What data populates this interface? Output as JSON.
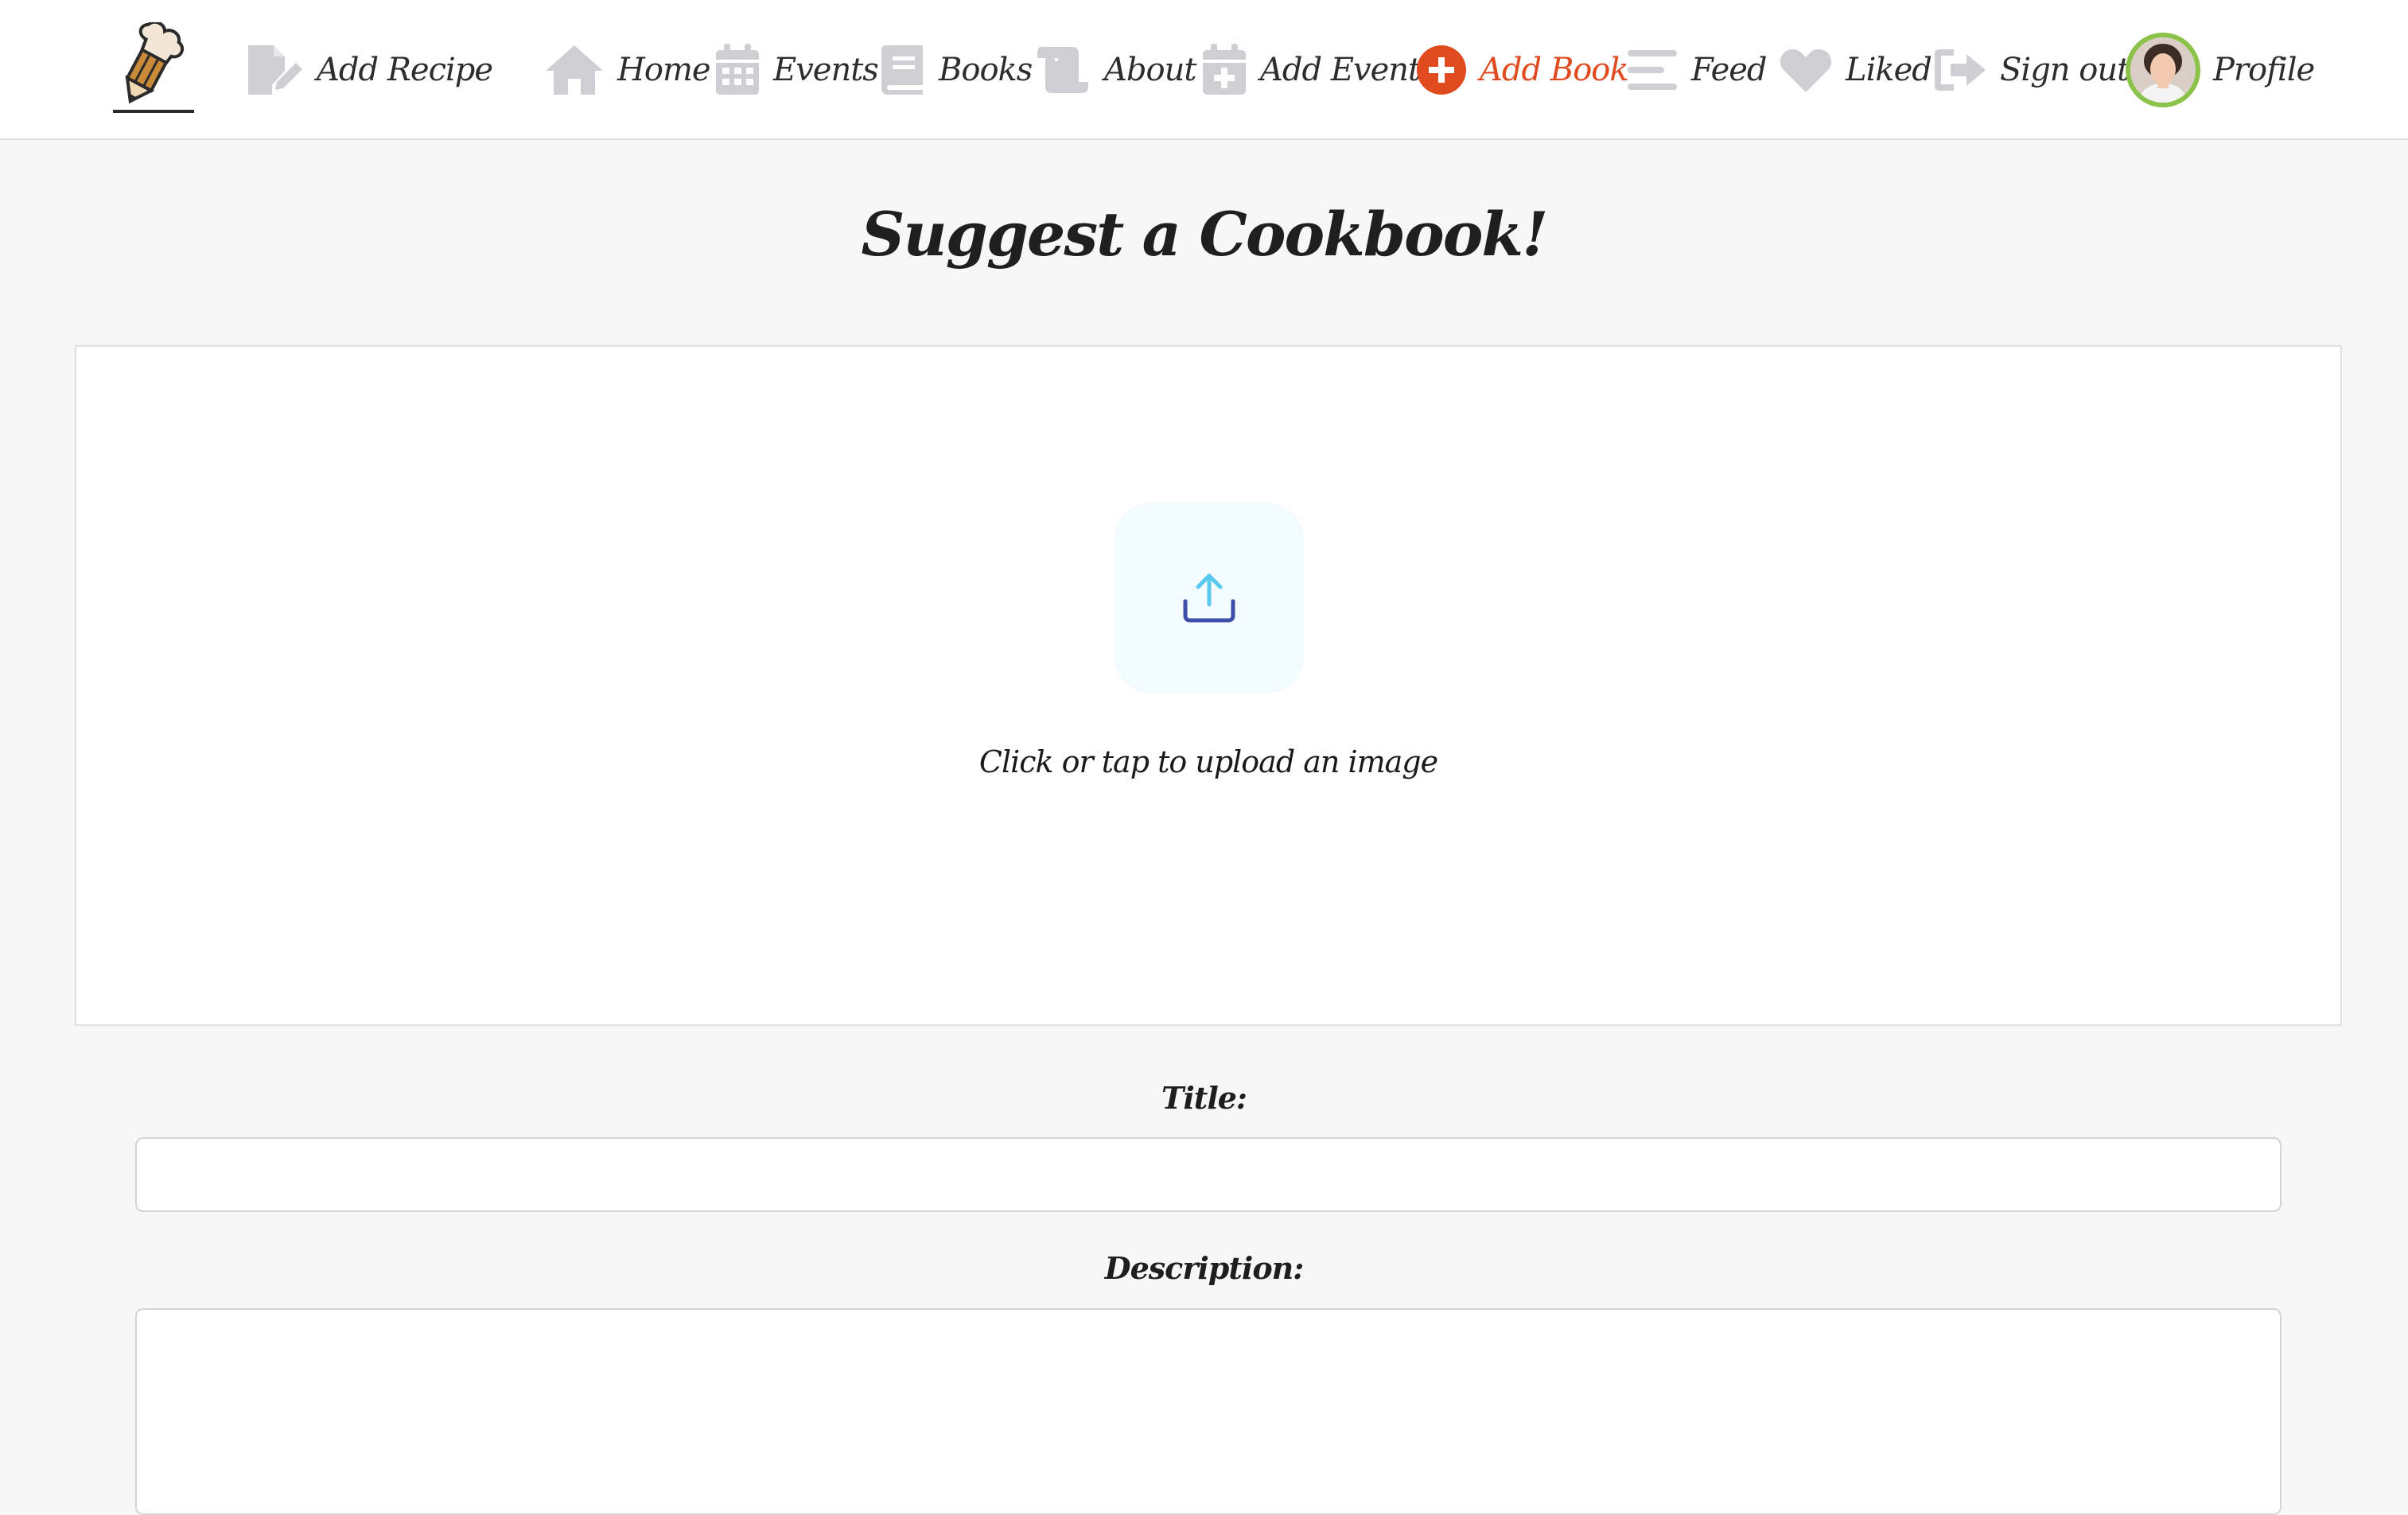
{
  "nav": {
    "logo_name": "chef-hat-pencil-logo",
    "items": [
      {
        "label": "Add Recipe",
        "icon": "document-edit-icon"
      },
      {
        "label": "Home",
        "icon": "house-icon"
      },
      {
        "label": "Events",
        "icon": "calendar-icon"
      },
      {
        "label": "Books",
        "icon": "book-icon"
      },
      {
        "label": "About",
        "icon": "scroll-icon"
      },
      {
        "label": "Add Event",
        "icon": "calendar-plus-icon"
      },
      {
        "label": "Add Book",
        "icon": "plus-circle-icon",
        "active": true
      },
      {
        "label": "Feed",
        "icon": "lines-icon"
      },
      {
        "label": "Liked",
        "icon": "heart-icon"
      },
      {
        "label": "Sign out",
        "icon": "sign-out-icon"
      },
      {
        "label": "Profile",
        "icon": "avatar"
      }
    ]
  },
  "page": {
    "title": "Suggest a Cookbook!"
  },
  "upload": {
    "text": "Click or tap to upload an image",
    "icon": "upload-icon"
  },
  "form": {
    "title_label": "Title:",
    "title_value": "",
    "description_label": "Description:",
    "description_value": ""
  },
  "colors": {
    "accent": "#e04a1f",
    "icon_gray": "#cfcfd3",
    "avatar_ring": "#8bc34a",
    "upload_tile": "#f2fbff",
    "upload_arrow": "#5bc8ee",
    "upload_tray": "#3f4ea8"
  }
}
